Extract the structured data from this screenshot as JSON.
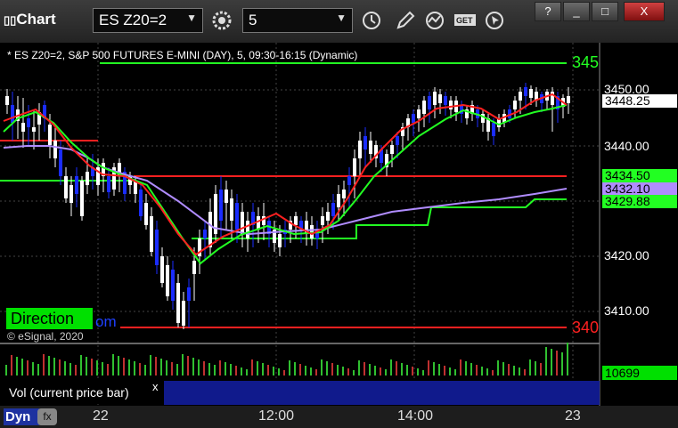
{
  "app": {
    "title": "Chart"
  },
  "toolbar": {
    "symbol": "ES Z20=2",
    "interval": "5",
    "icons": [
      "gear-icon",
      "clock-icon",
      "pencil-icon",
      "study-icon",
      "get-icon",
      "cursor-icon"
    ]
  },
  "window_controls": [
    "?",
    "_",
    "□",
    "X"
  ],
  "chart": {
    "info": "* ES Z20=2, S&P 500 FUTURES E-MINI (DAY), 5, 09:30-16:15 (Dynamic)",
    "copyright": "© eSignal, 2020",
    "direction_label": "Direction",
    "direction_link": "om",
    "price_labels": [
      "3450.00",
      "3440.00",
      "3420.00",
      "3410.00"
    ],
    "current_price": "3448.25",
    "level_labels": {
      "upper": "3434.50",
      "avg": "3432.10",
      "lower": "3429.88"
    },
    "edge_labels": {
      "top": "345",
      "bottom": "340"
    },
    "time_labels": [
      "22",
      "12:00",
      "14:00",
      "23"
    ],
    "colors": {
      "up": "#ffffff",
      "down": "#1a2cff",
      "red": "#ff2020",
      "green": "#22ff22",
      "purple": "#b08cff",
      "accent": "#00e000"
    }
  },
  "volume": {
    "label": "Vol (current price bar)",
    "close_x": "x",
    "value": "10699"
  },
  "footer": {
    "dyn": "Dyn",
    "fx": "fx"
  }
}
